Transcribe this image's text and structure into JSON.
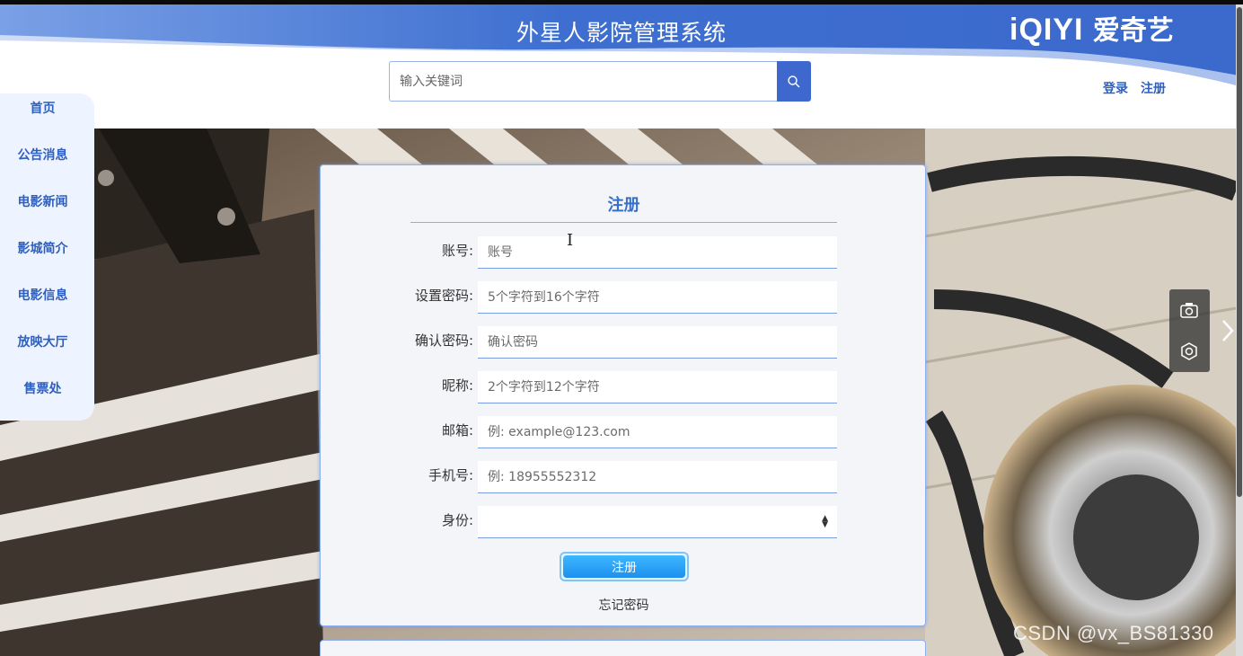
{
  "header": {
    "title": "外星人影院管理系统",
    "brand_latin": "iQIYI",
    "brand_cn": "爱奇艺",
    "login": "登录",
    "register": "注册"
  },
  "search": {
    "placeholder": "输入关键词",
    "icon": "search-icon"
  },
  "sidebar": {
    "items": [
      {
        "label": "首页"
      },
      {
        "label": "公告消息"
      },
      {
        "label": "电影新闻"
      },
      {
        "label": "影城简介"
      },
      {
        "label": "电影信息"
      },
      {
        "label": "放映大厅"
      },
      {
        "label": "售票处"
      }
    ]
  },
  "form": {
    "title": "注册",
    "fields": [
      {
        "label": "账号:",
        "placeholder": "账号",
        "value": ""
      },
      {
        "label": "设置密码:",
        "placeholder": "5个字符到16个字符",
        "value": ""
      },
      {
        "label": "确认密码:",
        "placeholder": "确认密码",
        "value": ""
      },
      {
        "label": "昵称:",
        "placeholder": "2个字符到12个字符",
        "value": ""
      },
      {
        "label": "邮箱:",
        "placeholder": "例: example@123.com",
        "value": ""
      },
      {
        "label": "手机号:",
        "placeholder": "例: 18955552312",
        "value": ""
      }
    ],
    "role": {
      "label": "身份:",
      "selected": ""
    },
    "submit_label": "注册",
    "forgot_label": "忘记密码"
  },
  "tools": {
    "camera_icon": "camera-icon",
    "lens_icon": "lens-icon",
    "next_icon": "chevron-right-icon"
  },
  "watermark": "CSDN @vx_BS81330",
  "colors": {
    "header_blue": "#2f5fbf",
    "accent_blue": "#3670c9",
    "button_blue": "#1e8fee",
    "nav_bg": "#eef4ff"
  }
}
